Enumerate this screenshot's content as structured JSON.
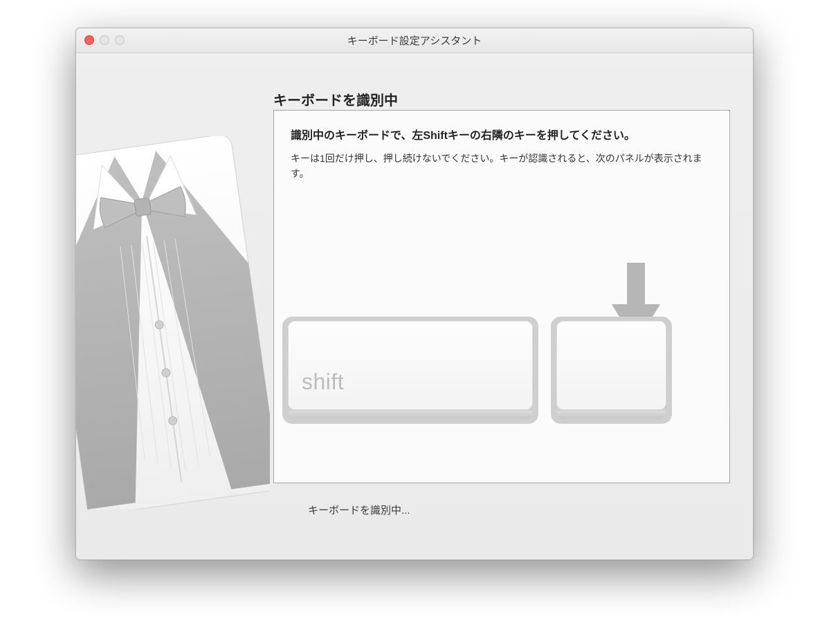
{
  "window": {
    "title": "キーボード設定アシスタント"
  },
  "heading": "キーボードを識別中",
  "panel": {
    "title": "識別中のキーボードで、左Shiftキーの右隣のキーを押してください。",
    "description": "キーは1回だけ押し、押し続けないでください。キーが認識されると、次のパネルが表示されます。"
  },
  "keys": {
    "shift_label": "shift"
  },
  "status": "キーボードを識別中..."
}
